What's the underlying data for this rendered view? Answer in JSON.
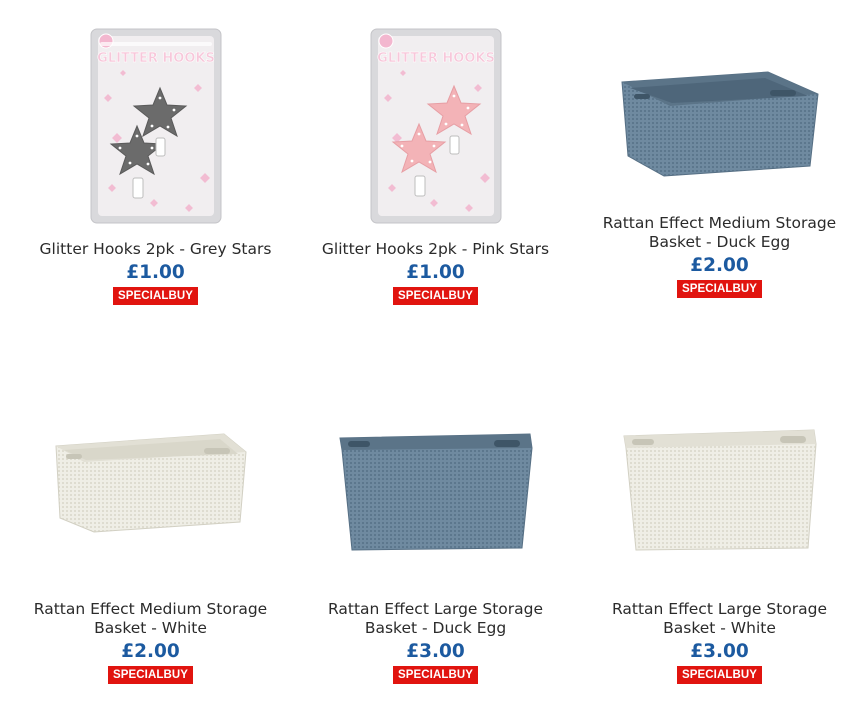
{
  "products": [
    {
      "title": "Glitter Hooks 2pk - Grey Stars",
      "price": "£1.00",
      "badge": "SPECIALBUY",
      "package_brand": "GLITTER HOOKS",
      "star_color": "#6b6b6b"
    },
    {
      "title": "Glitter Hooks 2pk - Pink Stars",
      "price": "£1.00",
      "badge": "SPECIALBUY",
      "package_brand": "GLITTER HOOKS",
      "star_color": "#f3b3b7"
    },
    {
      "title_line1": "Rattan Effect Medium Storage",
      "title_line2": "Basket - Duck Egg",
      "price": "£2.00",
      "badge": "SPECIALBUY",
      "basket_color": "#6f8aa0"
    },
    {
      "title_line1": "Rattan Effect Medium Storage",
      "title_line2": "Basket - White",
      "price": "£2.00",
      "badge": "SPECIALBUY",
      "basket_color": "#ecebe2"
    },
    {
      "title_line1": "Rattan Effect Large Storage",
      "title_line2": "Basket - Duck Egg",
      "price": "£3.00",
      "badge": "SPECIALBUY",
      "basket_color": "#6f8aa0"
    },
    {
      "title_line1": "Rattan Effect Large Storage",
      "title_line2": "Basket - White",
      "price": "£3.00",
      "badge": "SPECIALBUY",
      "basket_color": "#ecebe2"
    }
  ],
  "colors": {
    "price": "#1c5aa0",
    "badge_bg": "#e1140f",
    "title": "#2b2b2b"
  }
}
